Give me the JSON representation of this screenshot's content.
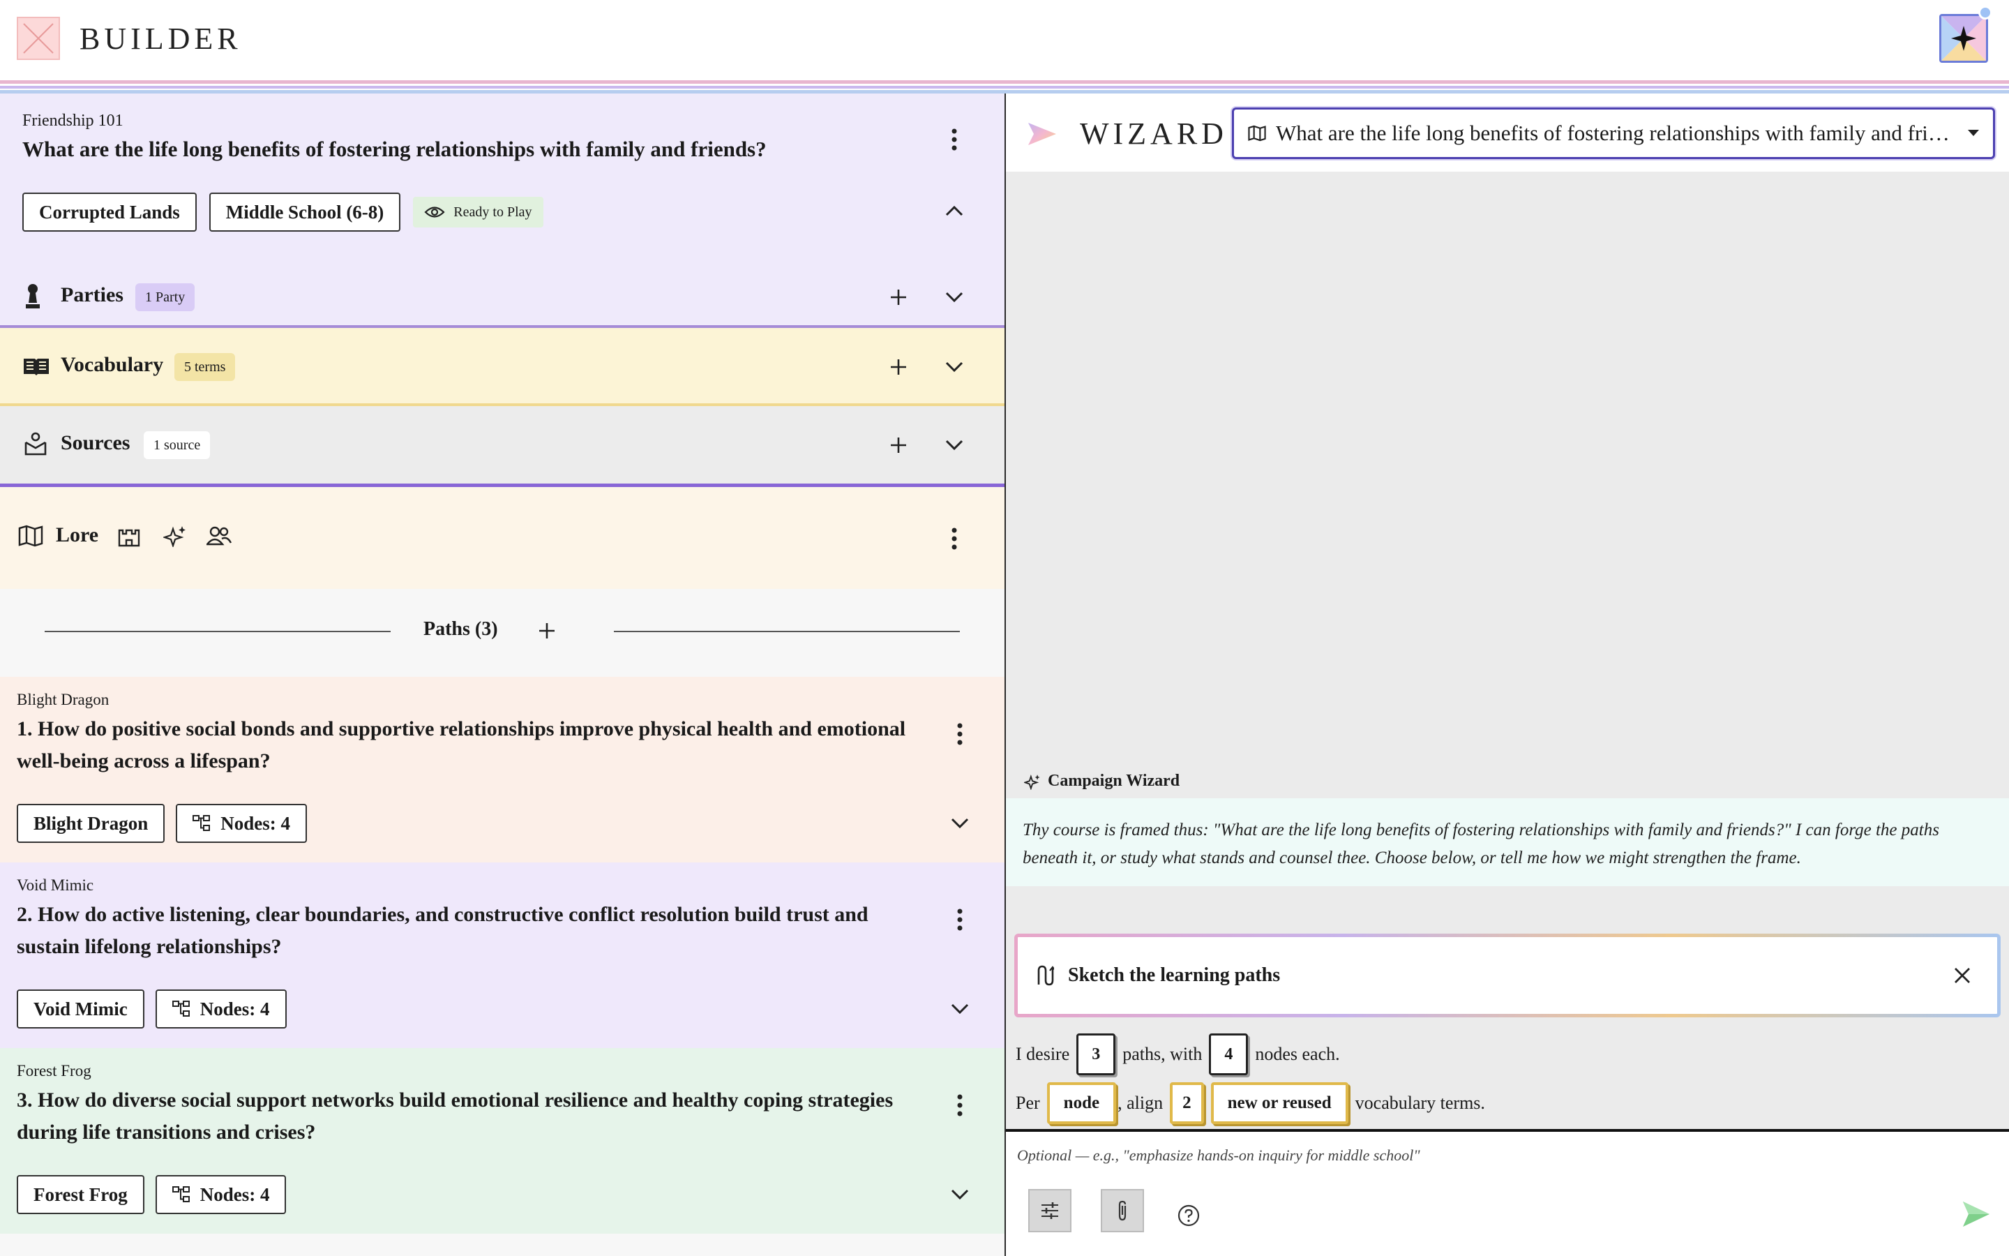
{
  "app": {
    "brand": "BUILDER"
  },
  "course": {
    "subtitle": "Friendship 101",
    "question": "What are the life long benefits of fostering relationships with family and friends?",
    "tags": [
      "Corrupted Lands",
      "Middle School (6-8)"
    ],
    "status": "Ready to Play"
  },
  "sections": {
    "parties": {
      "title": "Parties",
      "badge": "1 Party"
    },
    "vocabulary": {
      "title": "Vocabulary",
      "badge": "5 terms"
    },
    "sources": {
      "title": "Sources",
      "badge": "1 source"
    },
    "lore": {
      "title": "Lore"
    }
  },
  "paths": {
    "header": "Paths (3)",
    "items": [
      {
        "subtitle": "Blight Dragon",
        "question": "1. How do positive social bonds and supportive relationships improve physical health and emotional well-being across a lifespan?",
        "chip": "Blight Dragon",
        "nodes": "Nodes: 4",
        "bg": "#fcefe8"
      },
      {
        "subtitle": "Void Mimic",
        "question": "2. How do active listening, clear boundaries, and constructive conflict resolution build trust and sustain lifelong relationships?",
        "chip": "Void Mimic",
        "nodes": "Nodes: 4",
        "bg": "#efe8fb"
      },
      {
        "subtitle": "Forest Frog",
        "question": "3. How do diverse social support networks build emotional resilience and healthy coping strategies during life transitions and crises?",
        "chip": "Forest Frog",
        "nodes": "Nodes: 4",
        "bg": "#e6f4ea"
      }
    ]
  },
  "wizard": {
    "brand": "WIZARD",
    "selected": "What are the life long benefits of fostering relationships with family and friends?",
    "assistant_label": "Campaign Wizard",
    "message": "Thy course is framed thus: \"What are the life long benefits of fostering relationships with family and friends?\" I can forge the paths beneath it, or study what stands and counsel thee. Choose below, or tell me how we might strengthen the frame.",
    "sketch_title": "Sketch the learning paths",
    "form": {
      "t1": "I desire",
      "paths_count": "3",
      "t2": "paths, with",
      "nodes_count": "4",
      "t3": "nodes each.",
      "t4": "Per",
      "per_unit": "node",
      "t5": ", align",
      "align_count": "2",
      "vocab_mode": "new or reused",
      "t6": "vocabulary terms."
    },
    "composer_placeholder": "Optional — e.g., \"emphasize hands-on inquiry for middle school\""
  }
}
